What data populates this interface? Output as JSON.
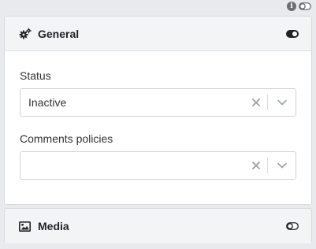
{
  "top_bar": {
    "icons": [
      "info-icon",
      "toggle-off-icon"
    ]
  },
  "general_panel": {
    "icon": "gears-icon",
    "title": "General",
    "toggle": "on",
    "fields": [
      {
        "label": "Status",
        "value": "Inactive",
        "placeholder": ""
      },
      {
        "label": "Comments policies",
        "value": "",
        "placeholder": ""
      }
    ]
  },
  "media_panel": {
    "icon": "image-icon",
    "title": "Media",
    "toggle": "off"
  },
  "colors": {
    "background": "#e8eaed",
    "panel_header": "#f3f4f6",
    "icon_gray": "#6b6f75"
  }
}
